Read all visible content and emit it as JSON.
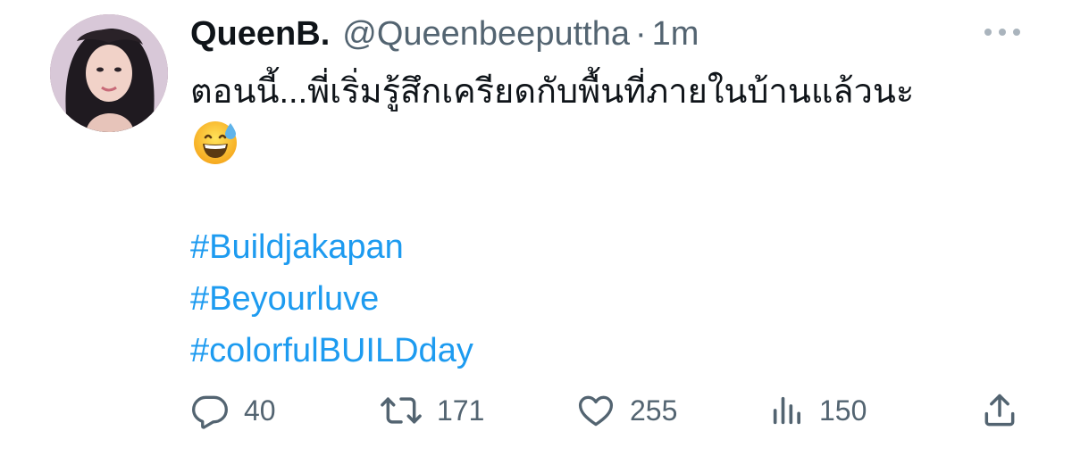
{
  "tweet": {
    "display_name": "QueenB.",
    "handle": "@Queenbeeputtha",
    "separator": "·",
    "time": "1m",
    "text": "ตอนนี้...พี่เริ่มรู้สึกเครียดกับพื้นที่ภายในบ้านแล้วนะ",
    "emoji": "grinning-face-with-sweat",
    "hashtags": [
      "#Buildjakapan",
      "#Beyourluve",
      "#colorfulBUILDday"
    ]
  },
  "actions": {
    "replies": "40",
    "retweets": "171",
    "likes": "255",
    "views": "150"
  },
  "icons": {
    "more": "more-horizontal-icon",
    "reply": "reply-icon",
    "retweet": "retweet-icon",
    "like": "heart-icon",
    "views": "views-icon",
    "share": "share-icon"
  },
  "colors": {
    "text": "#0f1419",
    "secondary": "#536471",
    "link": "#1d9bf0"
  }
}
